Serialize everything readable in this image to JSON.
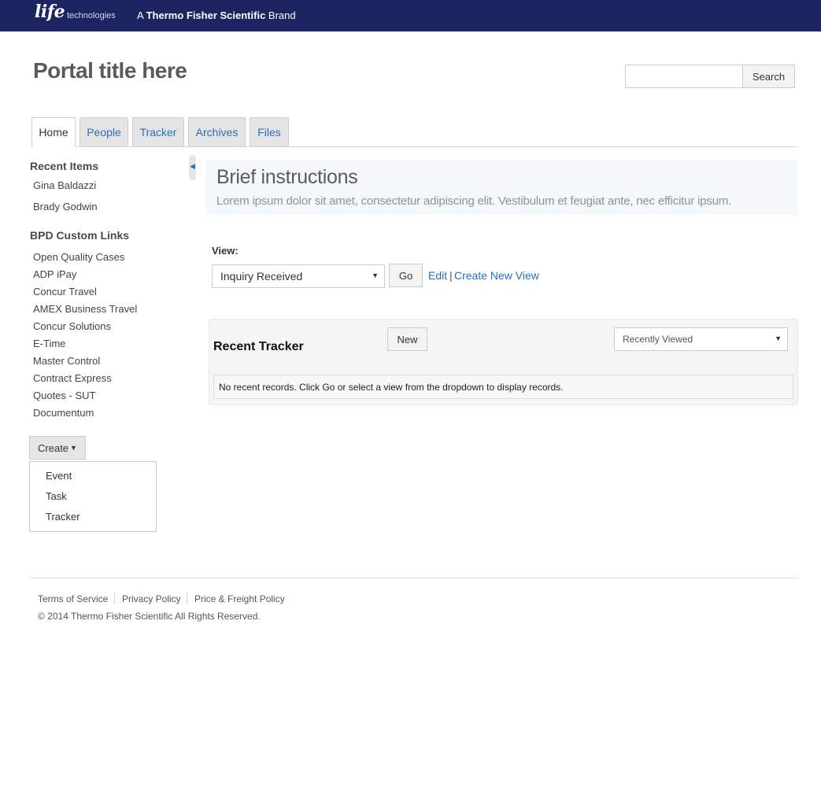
{
  "brand": {
    "logo_word": "life",
    "logo_sub": "technologies",
    "tagline_prefix": "A",
    "tagline_bold": "Thermo Fisher Scientific",
    "tagline_suffix": "Brand",
    "bar_color": "#1c2461"
  },
  "header": {
    "portal_title": "Portal title here",
    "search_placeholder": "",
    "search_label": "Search"
  },
  "tabs": [
    {
      "label": "Home",
      "active": true
    },
    {
      "label": "People",
      "active": false
    },
    {
      "label": "Tracker",
      "active": false
    },
    {
      "label": "Archives",
      "active": false
    },
    {
      "label": "Files",
      "active": false
    }
  ],
  "sidebar": {
    "recent_heading": "Recent Items",
    "recent_items": [
      "Gina Baldazzi",
      "Brady Godwin"
    ],
    "links_heading": "BPD Custom Links",
    "links": [
      "Open Quality Cases",
      "ADP iPay",
      "Concur Travel",
      "AMEX Business Travel",
      "Concur Solutions",
      "E-Time",
      "Master Control",
      "Contract Express",
      "Quotes - SUT",
      "Documentum"
    ],
    "create_label": "Create",
    "create_menu": [
      "Event",
      "Task",
      "Tracker"
    ]
  },
  "main": {
    "instructions_title": "Brief instructions",
    "instructions_body": "Lorem ipsum dolor sit amet, consectetur adipiscing elit. Vestibulum et feugiat ante, nec efficitur ipsum.",
    "view_label": "View:",
    "view_selected": "Inquiry Received",
    "go_label": "Go",
    "edit_label": "Edit",
    "separator": "|",
    "create_view_label": "Create New View",
    "tracker_title": "Recent Tracker",
    "new_label": "New",
    "recent_filter": "Recently Viewed",
    "empty_message": "No recent records. Click Go or select a view from the dropdown to display records."
  },
  "footer": {
    "links": [
      "Terms of Service",
      "Privacy Policy",
      "Price & Freight Policy"
    ],
    "copyright": "© 2014 Thermo Fisher Scientific All Rights Reserved."
  },
  "colors": {
    "link": "#2a6fb6",
    "tab_inactive_bg": "#e4e4e4",
    "instructions_bg": "#f5f8fb"
  }
}
